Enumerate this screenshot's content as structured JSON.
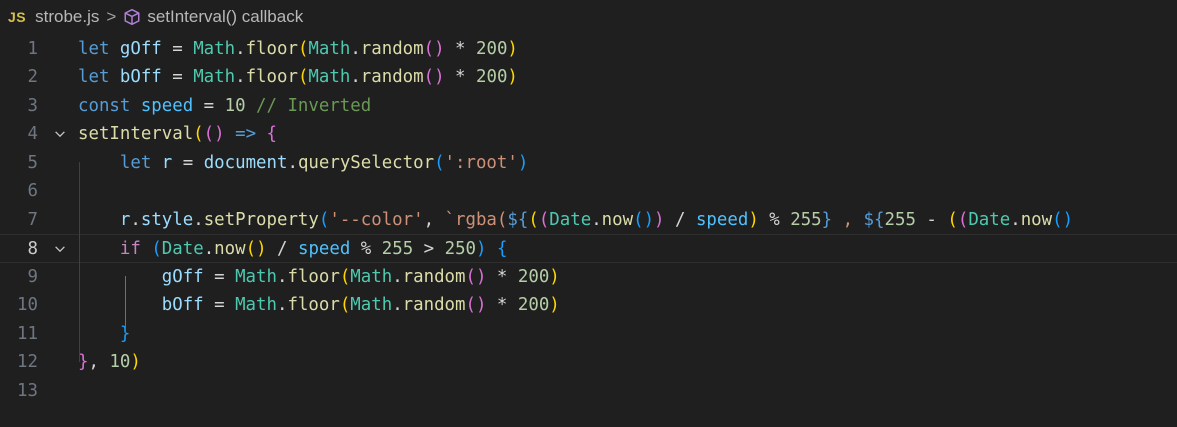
{
  "breadcrumb": {
    "lang_badge": "JS",
    "file": "strobe.js",
    "separator": ">",
    "symbol": "setInterval() callback"
  },
  "editor": {
    "active_line": 8,
    "lines": [
      {
        "n": "1",
        "tokens": [
          [
            "kw",
            "let "
          ],
          [
            "var",
            "gOff"
          ],
          [
            "op",
            " = "
          ],
          [
            "obj",
            "Math"
          ],
          [
            "op",
            "."
          ],
          [
            "fn",
            "floor"
          ],
          [
            "p1",
            "("
          ],
          [
            "obj",
            "Math"
          ],
          [
            "op",
            "."
          ],
          [
            "fn",
            "random"
          ],
          [
            "p2",
            "()"
          ],
          [
            "op",
            " * "
          ],
          [
            "num",
            "200"
          ],
          [
            "p1",
            ")"
          ]
        ]
      },
      {
        "n": "2",
        "tokens": [
          [
            "kw",
            "let "
          ],
          [
            "var",
            "bOff"
          ],
          [
            "op",
            " = "
          ],
          [
            "obj",
            "Math"
          ],
          [
            "op",
            "."
          ],
          [
            "fn",
            "floor"
          ],
          [
            "p1",
            "("
          ],
          [
            "obj",
            "Math"
          ],
          [
            "op",
            "."
          ],
          [
            "fn",
            "random"
          ],
          [
            "p2",
            "()"
          ],
          [
            "op",
            " * "
          ],
          [
            "num",
            "200"
          ],
          [
            "p1",
            ")"
          ]
        ]
      },
      {
        "n": "3",
        "tokens": [
          [
            "kw",
            "const "
          ],
          [
            "cst",
            "speed"
          ],
          [
            "op",
            " = "
          ],
          [
            "num",
            "10"
          ],
          [
            "op",
            " "
          ],
          [
            "cmt",
            "// Inverted"
          ]
        ]
      },
      {
        "n": "4",
        "fold": true,
        "tokens": [
          [
            "fn",
            "setInterval"
          ],
          [
            "p1",
            "("
          ],
          [
            "p2",
            "()"
          ],
          [
            "op",
            " "
          ],
          [
            "kw",
            "=>"
          ],
          [
            "op",
            " "
          ],
          [
            "p2",
            "{"
          ]
        ]
      },
      {
        "n": "5",
        "tokens": [
          [
            "op",
            "    "
          ],
          [
            "kw",
            "let "
          ],
          [
            "var",
            "r"
          ],
          [
            "op",
            " = "
          ],
          [
            "var",
            "document"
          ],
          [
            "op",
            "."
          ],
          [
            "fn",
            "querySelector"
          ],
          [
            "p3",
            "("
          ],
          [
            "str",
            "':root'"
          ],
          [
            "p3",
            ")"
          ]
        ]
      },
      {
        "n": "6",
        "tokens": []
      },
      {
        "n": "7",
        "tokens": [
          [
            "op",
            "    "
          ],
          [
            "var",
            "r"
          ],
          [
            "op",
            "."
          ],
          [
            "var",
            "style"
          ],
          [
            "op",
            "."
          ],
          [
            "fn",
            "setProperty"
          ],
          [
            "p3",
            "("
          ],
          [
            "str",
            "'--color'"
          ],
          [
            "op",
            ", "
          ],
          [
            "str",
            "`rgba("
          ],
          [
            "kw",
            "${"
          ],
          [
            "p1",
            "("
          ],
          [
            "p2",
            "("
          ],
          [
            "obj",
            "Date"
          ],
          [
            "op",
            "."
          ],
          [
            "fn",
            "now"
          ],
          [
            "p3",
            "()"
          ],
          [
            "p2",
            ")"
          ],
          [
            "op",
            " / "
          ],
          [
            "cst",
            "speed"
          ],
          [
            "p1",
            ")"
          ],
          [
            "op",
            " % "
          ],
          [
            "num",
            "255"
          ],
          [
            "kw",
            "}"
          ],
          [
            "str",
            " , "
          ],
          [
            "kw",
            "${"
          ],
          [
            "num",
            "255"
          ],
          [
            "op",
            " - "
          ],
          [
            "p1",
            "("
          ],
          [
            "p2",
            "("
          ],
          [
            "obj",
            "Date"
          ],
          [
            "op",
            "."
          ],
          [
            "fn",
            "now"
          ],
          [
            "p3",
            "()"
          ]
        ]
      },
      {
        "n": "8",
        "fold": true,
        "tokens": [
          [
            "op",
            "    "
          ],
          [
            "ctl",
            "if "
          ],
          [
            "p3",
            "("
          ],
          [
            "obj",
            "Date"
          ],
          [
            "op",
            "."
          ],
          [
            "fn",
            "now"
          ],
          [
            "p1",
            "()"
          ],
          [
            "op",
            " / "
          ],
          [
            "cst",
            "speed"
          ],
          [
            "op",
            " % "
          ],
          [
            "num",
            "255"
          ],
          [
            "op",
            " > "
          ],
          [
            "num",
            "250"
          ],
          [
            "p3",
            ")"
          ],
          [
            "op",
            " "
          ],
          [
            "p3",
            "{"
          ]
        ]
      },
      {
        "n": "9",
        "tokens": [
          [
            "op",
            "        "
          ],
          [
            "var",
            "gOff"
          ],
          [
            "op",
            " = "
          ],
          [
            "obj",
            "Math"
          ],
          [
            "op",
            "."
          ],
          [
            "fn",
            "floor"
          ],
          [
            "p1",
            "("
          ],
          [
            "obj",
            "Math"
          ],
          [
            "op",
            "."
          ],
          [
            "fn",
            "random"
          ],
          [
            "p2",
            "()"
          ],
          [
            "op",
            " * "
          ],
          [
            "num",
            "200"
          ],
          [
            "p1",
            ")"
          ]
        ]
      },
      {
        "n": "10",
        "tokens": [
          [
            "op",
            "        "
          ],
          [
            "var",
            "bOff"
          ],
          [
            "op",
            " = "
          ],
          [
            "obj",
            "Math"
          ],
          [
            "op",
            "."
          ],
          [
            "fn",
            "floor"
          ],
          [
            "p1",
            "("
          ],
          [
            "obj",
            "Math"
          ],
          [
            "op",
            "."
          ],
          [
            "fn",
            "random"
          ],
          [
            "p2",
            "()"
          ],
          [
            "op",
            " * "
          ],
          [
            "num",
            "200"
          ],
          [
            "p1",
            ")"
          ]
        ]
      },
      {
        "n": "11",
        "tokens": [
          [
            "op",
            "    "
          ],
          [
            "p3",
            "}"
          ]
        ]
      },
      {
        "n": "12",
        "tokens": [
          [
            "p2",
            "}"
          ],
          [
            "op",
            ", "
          ],
          [
            "num",
            "10"
          ],
          [
            "p1",
            ")"
          ]
        ]
      },
      {
        "n": "13",
        "tokens": []
      }
    ]
  }
}
